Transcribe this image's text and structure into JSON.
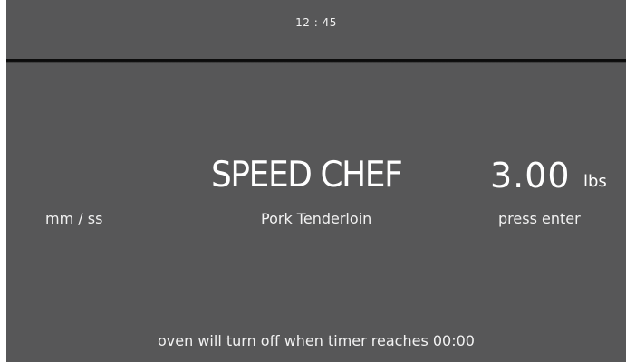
{
  "status_bar": {
    "clock": "12 : 45"
  },
  "main": {
    "mode_title": "SPEED CHEF",
    "weight": {
      "value": "3.00",
      "unit": "lbs"
    },
    "time_format": "mm / ss",
    "food_name": "Pork Tenderloin",
    "enter_hint": "press enter",
    "timer_note": "oven will turn off when timer reaches 00:00"
  },
  "colors": {
    "background": "#575758",
    "divider": "#0c0c0c",
    "text": "#ffffff"
  }
}
